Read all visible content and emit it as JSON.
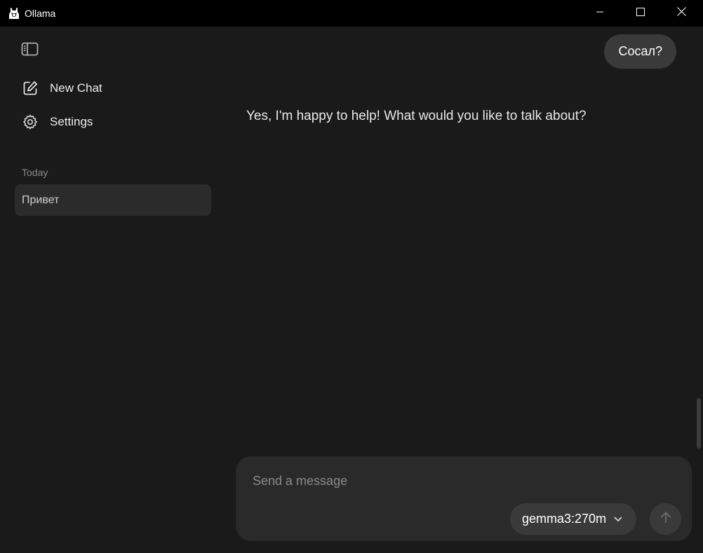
{
  "window": {
    "title": "Ollama"
  },
  "sidebar": {
    "new_chat_label": "New Chat",
    "settings_label": "Settings",
    "section_heading": "Today",
    "history": [
      {
        "label": "Привет"
      }
    ]
  },
  "conversation": {
    "user_message": "Сосал?",
    "assistant_message": "Yes, I'm happy to help! What would you like to talk about?"
  },
  "composer": {
    "placeholder": "Send a message",
    "model": "gemma3:270m"
  },
  "icons": {
    "app": "ollama-llama-icon",
    "minimize": "minimize-icon",
    "maximize": "maximize-icon",
    "close": "close-icon",
    "sidebar_toggle": "sidebar-toggle-icon",
    "new_chat": "edit-square-icon",
    "settings": "gear-icon",
    "chevron": "chevron-down-icon",
    "send": "arrow-up-icon"
  },
  "colors": {
    "background": "#1a1a1a",
    "titlebar": "#000000",
    "bubble": "#3a3a3a",
    "history_selected": "#2b2b2b",
    "composer": "#2a2a2a",
    "muted_text": "#8a8a8a"
  }
}
